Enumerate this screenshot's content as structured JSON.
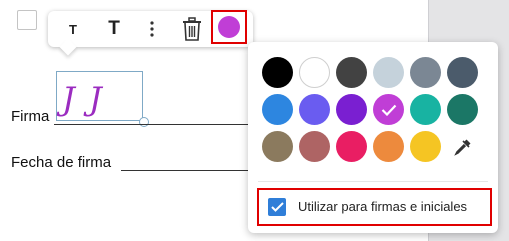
{
  "document": {
    "signature_label": "Firma",
    "date_label": "Fecha de firma",
    "signature_text": "JJ",
    "signature_color": "#9b2cc0"
  },
  "toolbar": {
    "items": [
      {
        "name": "text-smaller",
        "glyph": "T"
      },
      {
        "name": "text-larger",
        "glyph": "T"
      },
      {
        "name": "more-options",
        "icon": "vertical-dots-icon"
      },
      {
        "name": "delete",
        "icon": "trash-icon"
      },
      {
        "name": "color-picker",
        "color": "#c03ed6"
      }
    ]
  },
  "color_panel": {
    "colors": [
      "#000000",
      "#ffffff",
      "#424242",
      "#c5d2db",
      "#7b8794",
      "#4b5b6b",
      "#2d86e0",
      "#6a5cf0",
      "#7a1fd1",
      "#c03ed6",
      "#18b3a2",
      "#1b7766",
      "#8b7a5e",
      "#ae6464",
      "#e91e63",
      "#ed8a3d",
      "#f5c523"
    ],
    "selected_index": 9,
    "eyedropper_icon": "eyedropper-icon",
    "option": {
      "label": "Utilizar para firmas e iniciales",
      "checked": true
    },
    "highlight_color": "#e00000"
  }
}
